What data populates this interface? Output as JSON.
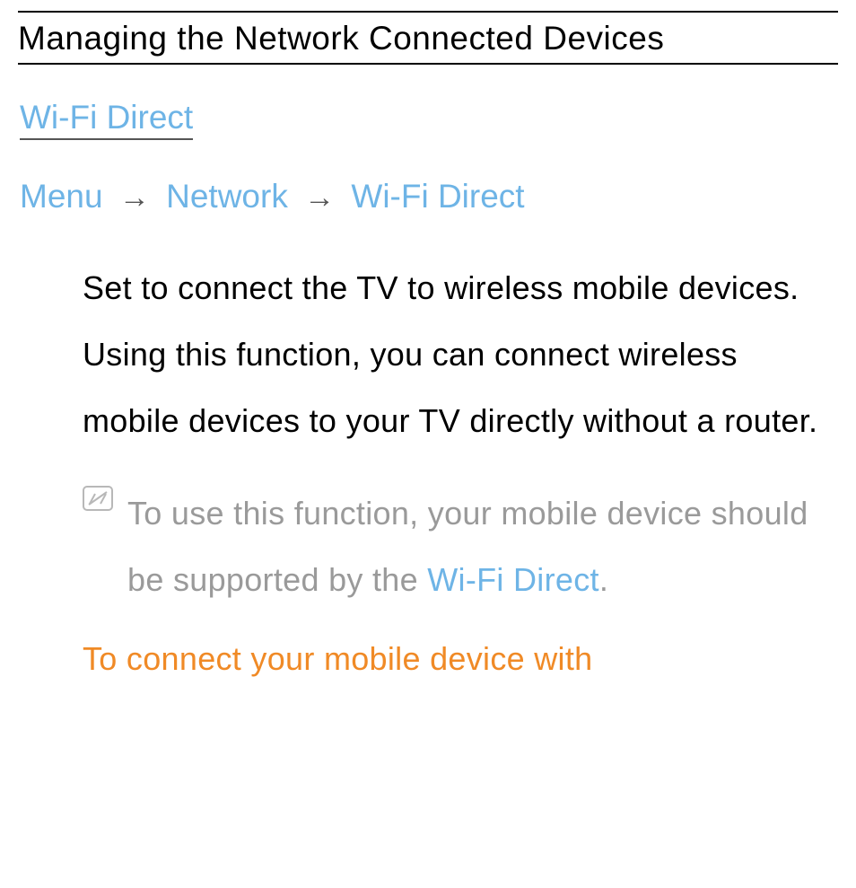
{
  "title": "Managing the Network Connected Devices",
  "section_heading": "Wi-Fi Direct",
  "breadcrumb": {
    "items": [
      "Menu",
      "Network",
      "Wi-Fi Direct"
    ],
    "separator": "→"
  },
  "body_paragraph": "Set to connect the TV to wireless mobile devices. Using this function, you can connect wireless mobile devices to your TV directly without a router.",
  "note": {
    "icon_name": "note-icon",
    "text_before": "To use this function, your mobile device should be supported by the ",
    "highlight": "Wi-Fi Direct",
    "text_after": "."
  },
  "continuation_text": "To connect your mobile device with"
}
